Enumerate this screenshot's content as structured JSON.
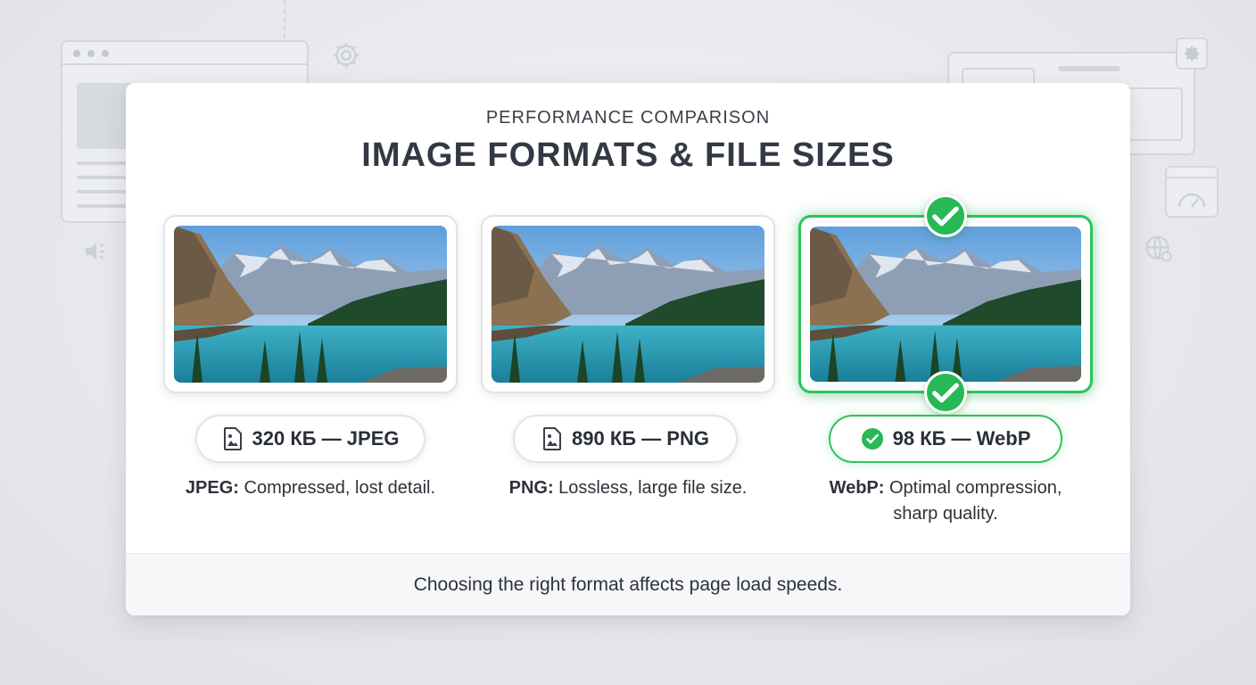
{
  "header": {
    "eyebrow": "PERFORMANCE COMPARISON",
    "title": "IMAGE FORMATS & FILE SIZES"
  },
  "formats": [
    {
      "name": "JPEG",
      "size_label": "320 КБ — JPEG",
      "desc_bold": "JPEG:",
      "desc_text": " Compressed, lost detail.",
      "best": false,
      "icon": "image-file-icon"
    },
    {
      "name": "PNG",
      "size_label": "890 КБ — PNG",
      "desc_bold": "PNG:",
      "desc_text": " Lossless, large file size.",
      "best": false,
      "icon": "image-file-icon"
    },
    {
      "name": "WebP",
      "size_label": "98 КБ — WebP",
      "desc_bold": "WebP:",
      "desc_text": " Optimal compression, sharp quality.",
      "best": true,
      "icon": "check-circle-icon"
    }
  ],
  "footer": {
    "text": "Choosing the right format affects page load speeds."
  },
  "colors": {
    "accent_green": "#26b955",
    "text_dark": "#333944",
    "card_bg": "#ffffff",
    "footer_bg": "#f6f7f9"
  }
}
